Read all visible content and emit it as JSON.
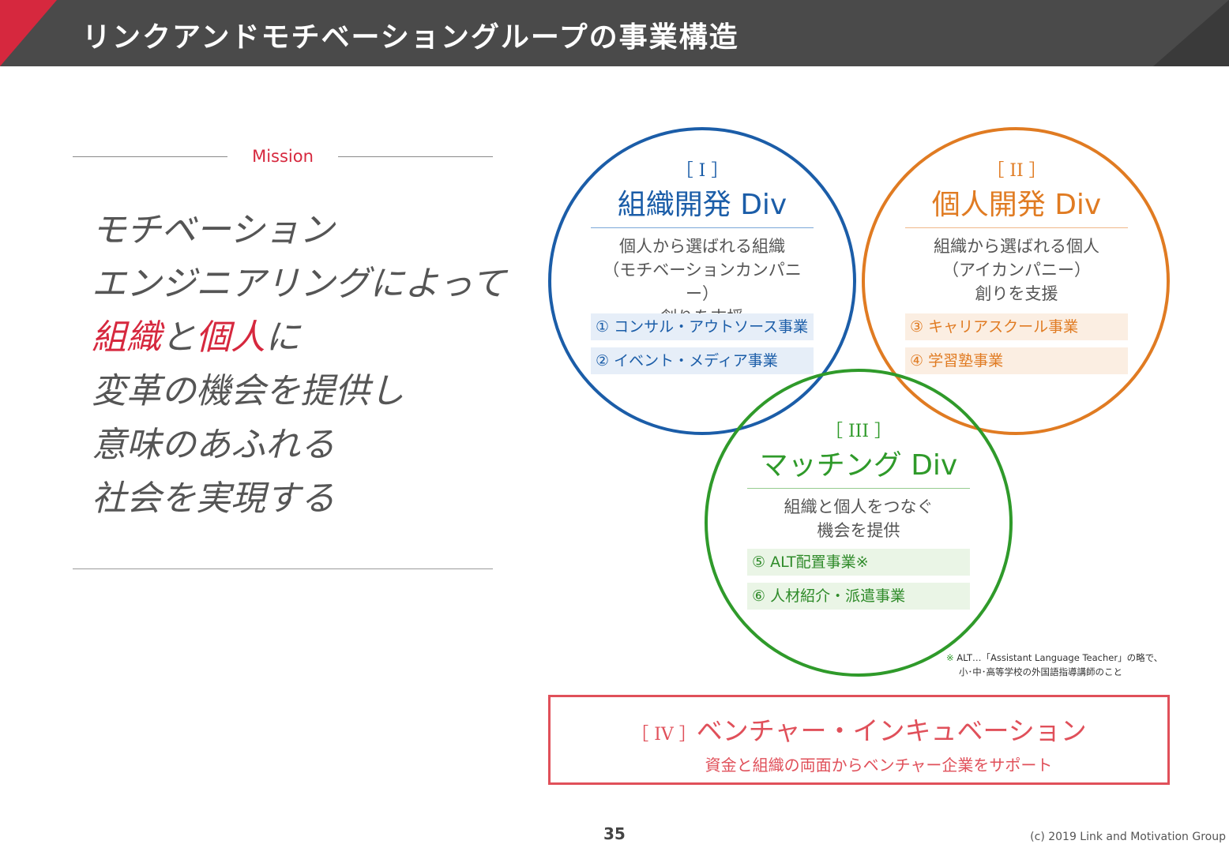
{
  "header": {
    "title": "リンクアンドモチベーショングループの事業構造"
  },
  "mission": {
    "label": "Mission",
    "lines": [
      [
        {
          "text": "モチベーション",
          "highlight": false
        }
      ],
      [
        {
          "text": "エンジニアリングによって",
          "highlight": false
        }
      ],
      [
        {
          "text": "組織",
          "highlight": true
        },
        {
          "text": "と",
          "highlight": false
        },
        {
          "text": "個人",
          "highlight": true
        },
        {
          "text": "に",
          "highlight": false
        }
      ],
      [
        {
          "text": "変革の機会を提供し",
          "highlight": false
        }
      ],
      [
        {
          "text": "意味のあふれる",
          "highlight": false
        }
      ],
      [
        {
          "text": "社会を実現する",
          "highlight": false
        }
      ]
    ]
  },
  "divisions": [
    {
      "num": "［ I ］",
      "name": "組織開発 Div",
      "desc": [
        "個人から選ばれる組織",
        "（モチベーションカンパニー）",
        "創りを支援"
      ],
      "businesses": [
        "① コンサル・アウトソース事業",
        "② イベント・メディア事業"
      ],
      "color": "#1b5da8"
    },
    {
      "num": "［ II ］",
      "name": "個人開発 Div",
      "desc": [
        "組織から選ばれる個人",
        "（アイカンパニー）",
        "創りを支援"
      ],
      "businesses": [
        "③ キャリアスクール事業",
        "④ 学習塾事業"
      ],
      "color": "#e07b22"
    },
    {
      "num": "［ III ］",
      "name": "マッチング Div",
      "desc": [
        "組織と個人をつなぐ",
        "機会を提供"
      ],
      "businesses": [
        "⑤ ALT配置事業※",
        "⑥ 人材紹介・派遣事業"
      ],
      "color": "#2f9a2a"
    }
  ],
  "footnote": {
    "mark": "※",
    "line1": "ALT…「Assistant Language Teacher」の略で、",
    "line2": "小･中･高等学校の外国語指導講師のこと"
  },
  "venture": {
    "num": "［ IV ］",
    "title": "ベンチャー・インキュベーション",
    "subtitle": "資金と組織の両面からベンチャー企業をサポート",
    "color": "#e0505a"
  },
  "footer": {
    "page_number": "35",
    "copyright": "(c) 2019 Link and Motivation Group"
  },
  "colors": {
    "accent": "#d6283e",
    "header_bg": "#4a4a4a"
  }
}
